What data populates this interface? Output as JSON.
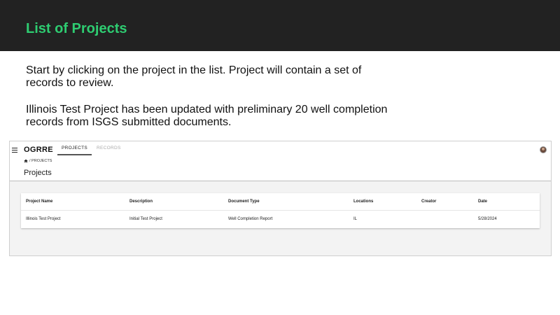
{
  "slide": {
    "title": "List of Projects",
    "paragraphs": [
      "Start by clicking on the project in the list. Project will contain a set of records to review.",
      "Illinois Test Project has been updated with preliminary 20 well completion records from ISGS submitted documents."
    ]
  },
  "app": {
    "logo": "OGRRE",
    "tabs": [
      {
        "label": "PROJECTS",
        "active": true
      },
      {
        "label": "RECORDS",
        "active": false
      }
    ],
    "breadcrumb": "/ PROJECTS",
    "page_title": "Projects",
    "table": {
      "headers": [
        "Project Name",
        "Description",
        "Document Type",
        "Locations",
        "Creator",
        "Date"
      ],
      "rows": [
        [
          "Illinois Test Project",
          "Initial Test Project",
          "Well Completion Report",
          "IL",
          "",
          "5/28/2024"
        ]
      ]
    }
  },
  "colors": {
    "header_bg": "#222222",
    "title_green": "#2ecc71"
  },
  "icons": [
    "menu-icon",
    "home-icon",
    "avatar"
  ]
}
